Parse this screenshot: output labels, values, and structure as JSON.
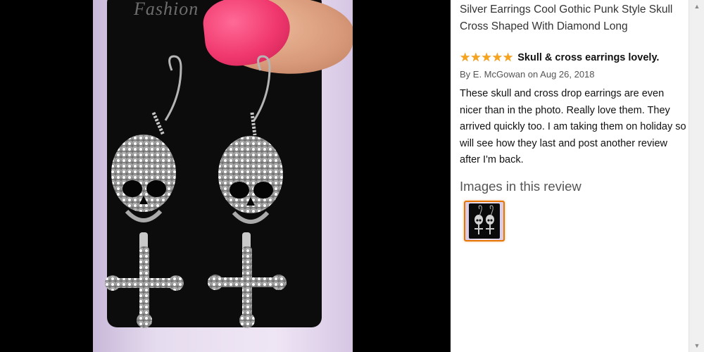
{
  "viewer": {
    "card_brand": "Fashion"
  },
  "review": {
    "product_title": "Silver Earrings Cool Gothic Punk Style Skull Cross Shaped With Diamond Long",
    "rating": 5,
    "rating_max": 5,
    "review_title": "Skull & cross earrings lovely.",
    "byline": "By E. McGowan on Aug 26, 2018",
    "body": "These skull and cross drop earrings are even nicer than in the photo. Really love them. They arrived quickly too. I am taking them on holiday so will see how they last and post another review after I'm back.",
    "images_heading": "Images in this review",
    "thumbnail_count": 1
  },
  "colors": {
    "star": "#f7a41c",
    "thumb_border_selected": "#e77600",
    "viewer_bg": "#000000",
    "nail": "#f0386e"
  },
  "icons": {
    "star": "star-icon",
    "scroll_up": "scroll-up-arrow-icon",
    "scroll_down": "scroll-down-arrow-icon"
  }
}
